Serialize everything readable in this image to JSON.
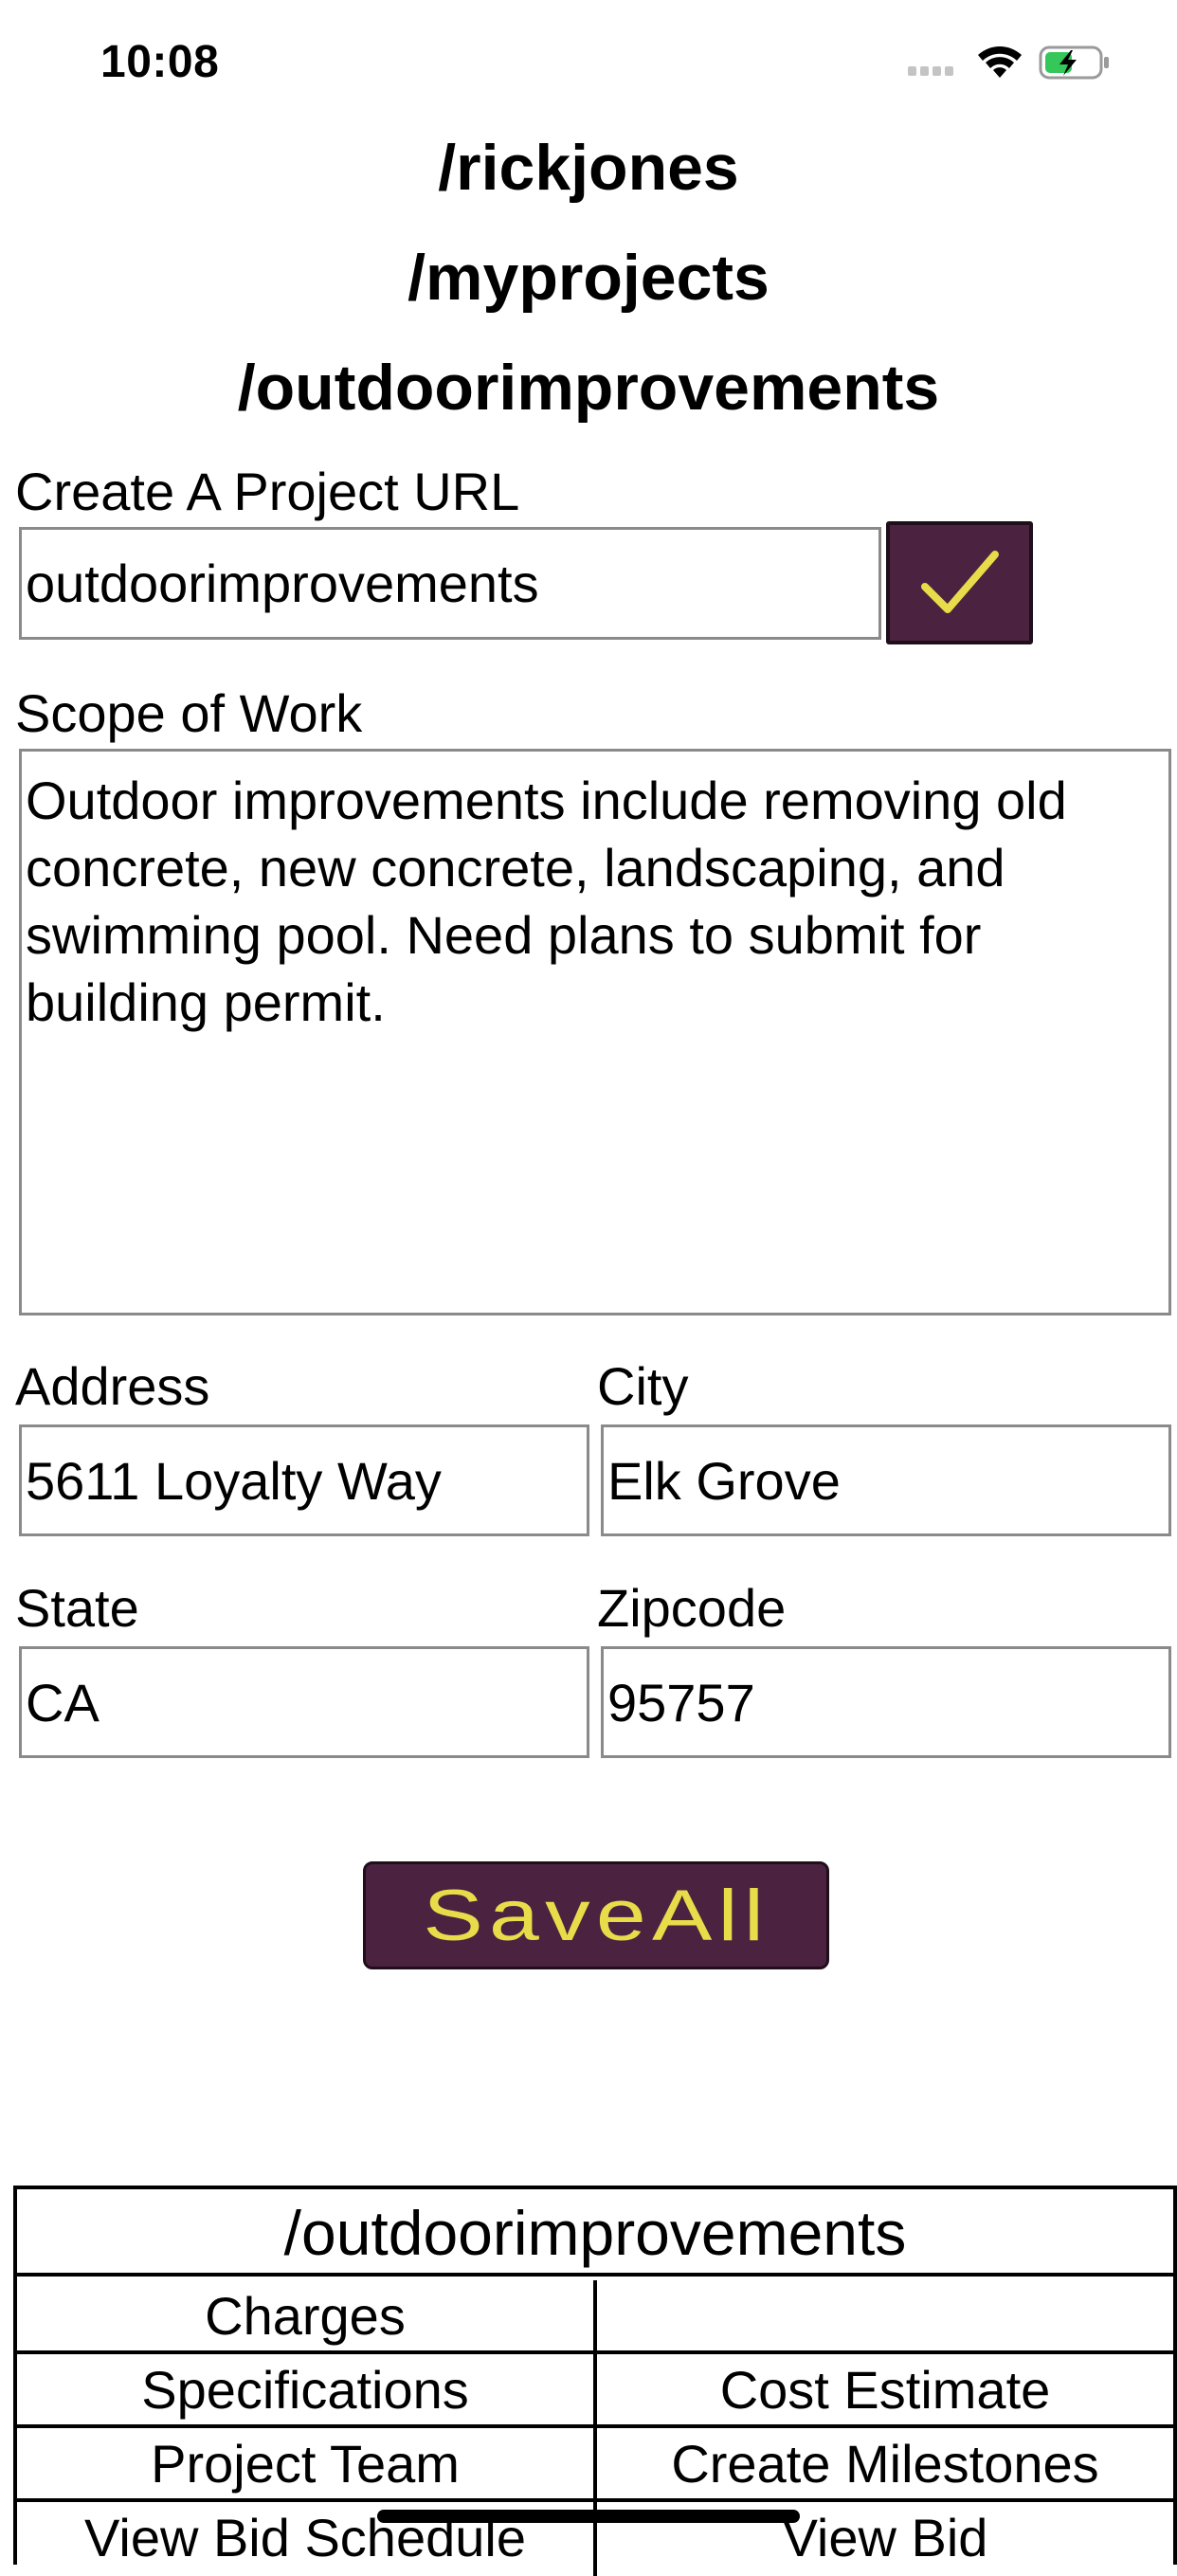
{
  "status_bar": {
    "time": "10:08"
  },
  "header": {
    "path_user": "/rickjones",
    "path_section": "/myprojects",
    "path_project": "/outdoorimprovements"
  },
  "project_url": {
    "label": "Create A Project URL",
    "value": "outdoorimprovements"
  },
  "scope": {
    "label": "Scope of Work",
    "lines": [
      "Outdoor improvements include removing old",
      "concrete, new concrete, landscaping, and",
      "swimming pool. Need plans to submit for",
      "building permit."
    ]
  },
  "address": {
    "label": "Address",
    "value": "5611 Loyalty Way"
  },
  "city": {
    "label": "City",
    "value": "Elk Grove"
  },
  "state": {
    "label": "State",
    "value": "CA"
  },
  "zipcode": {
    "label": "Zipcode",
    "value": "95757"
  },
  "save_button": {
    "label": "SaveAll"
  },
  "nav": {
    "title": "/outdoorimprovements",
    "items": [
      {
        "left": "Charges",
        "right": ""
      },
      {
        "left": "Specifications",
        "right": "Cost Estimate"
      },
      {
        "left": "Project Team",
        "right": "Create Milestones"
      },
      {
        "left": "View Bid Schedule",
        "right": "View Bid"
      }
    ]
  },
  "colors": {
    "button_bg": "#4b2240",
    "button_text": "#e9dc4a",
    "battery_fill": "#35c759"
  }
}
